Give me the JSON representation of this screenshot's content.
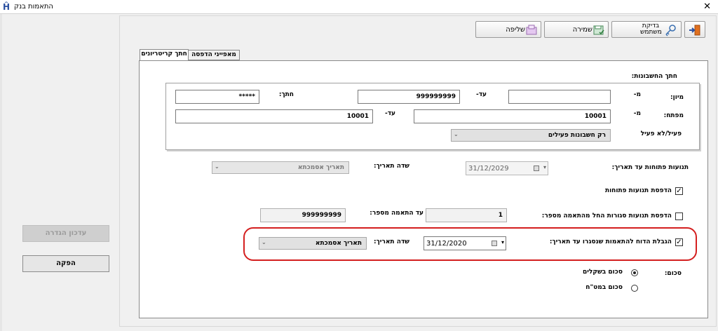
{
  "window": {
    "title": "התאמות בנק",
    "close": "✕"
  },
  "toolbar": {
    "exit_icon": "exit-door-icon",
    "check_user_label": "בדיקת משתמש",
    "save_label": "שמירה",
    "retrieve_label": "שליפה"
  },
  "tabs": [
    {
      "label": "מאפייני הדפסה",
      "active": false
    },
    {
      "label": "חתך קריטריונים",
      "active": true
    }
  ],
  "accounts_section": {
    "title": "חתך החשבונות:",
    "sort_label": "מיון:",
    "from_label": "מ-",
    "to_label": "עד-",
    "sort_from": "",
    "sort_to": "999999999",
    "section_label": "חתך:",
    "section_value": "*****",
    "key_label": "מפתח:",
    "key_from": "10001",
    "key_to": "10001",
    "active_label": "פעיל/לא פעיל",
    "active_value": "רק חשבונות פעילים"
  },
  "open_moves": {
    "label": "תנועות פתוחות עד תאריך:",
    "date": "31/12/2029",
    "date_field_label": "שדה תאריך:",
    "date_field_value": "תאריך אסמכתא"
  },
  "print_open": {
    "label": "הדפסת תנועות פתוחות",
    "checked": "✓"
  },
  "print_closed": {
    "label": "הדפסת תנועות סגורות החל מהתאמה מספר:",
    "from_value": "1",
    "to_label": "עד התאמה מספר:",
    "to_value": "999999999"
  },
  "limit_report": {
    "label": "הגבלת הדוח להתאמות שנסגרו עד תאריך:",
    "checked": "✓",
    "date": "31/12/2020",
    "date_field_label": "שדה תאריך:",
    "date_field_value": "תאריך אסמכתא"
  },
  "sum": {
    "label": "סכום:",
    "option_shekels": "סכום בשקלים",
    "option_foreign": "סכום במט\"ח"
  },
  "side_buttons": {
    "update_definition": "עדכון הגדרה",
    "produce": "הפקה"
  },
  "colors": {
    "highlight": "#d41f1f",
    "accent": "#2a4fa0"
  }
}
